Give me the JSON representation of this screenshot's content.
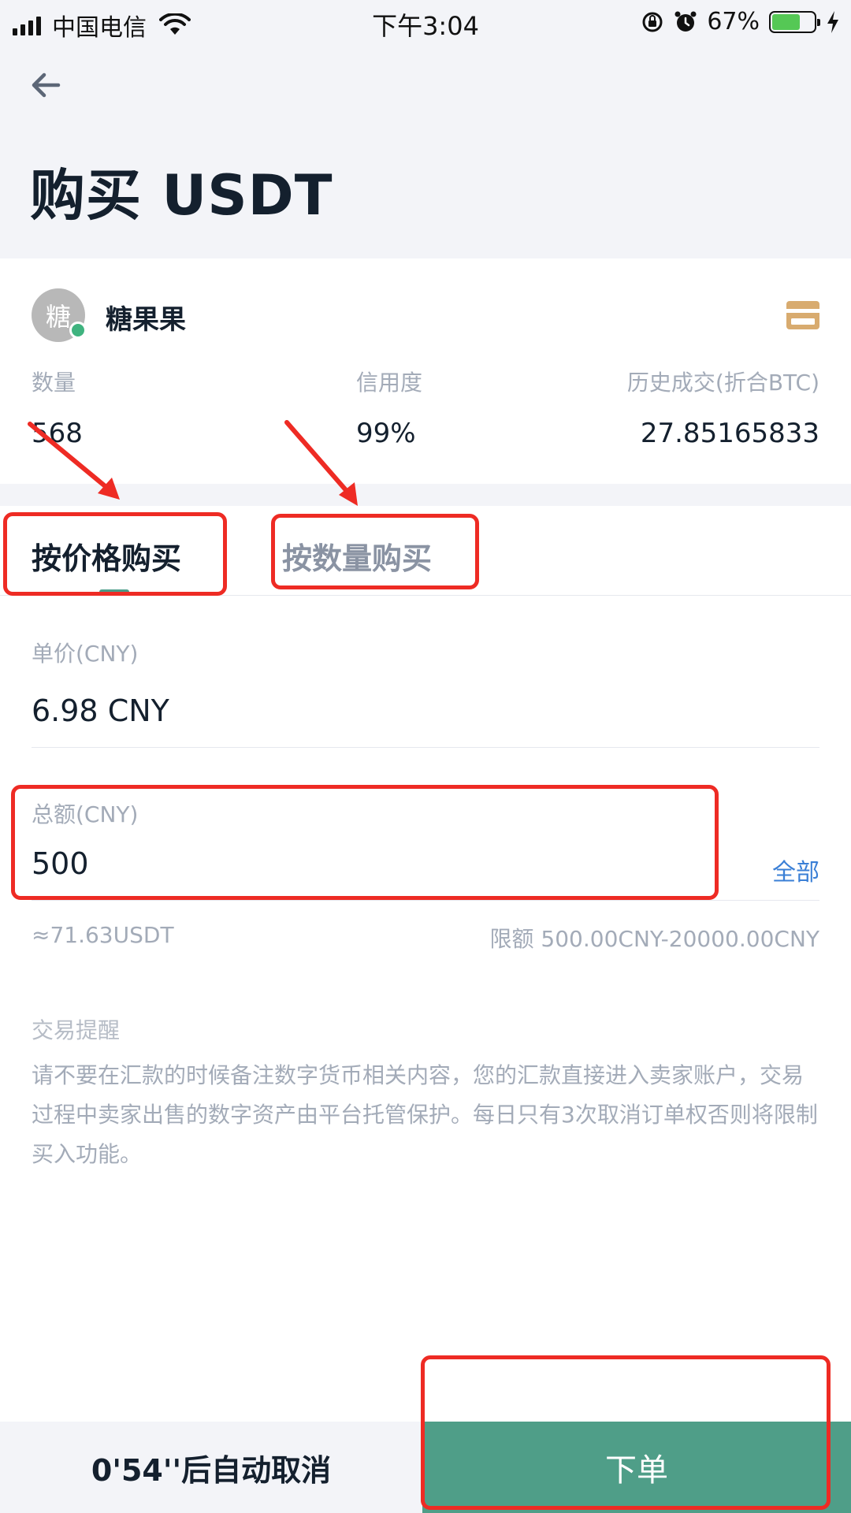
{
  "status_bar": {
    "carrier": "中国电信",
    "time": "下午3:04",
    "battery_pct": "67%",
    "battery_level": 0.67,
    "battery_color": "#55c855"
  },
  "header": {
    "back_icon": "arrow-left-icon",
    "title": "购买 USDT"
  },
  "seller": {
    "avatar_text": "糖",
    "name": "糖果果",
    "online_color": "#3fb37f",
    "payment_icon": "bank-card-icon",
    "stats": [
      {
        "label": "数量",
        "value": "568"
      },
      {
        "label": "信用度",
        "value": "99%"
      },
      {
        "label": "历史成交(折合BTC)",
        "value": "27.85165833"
      }
    ]
  },
  "tabs": [
    {
      "label": "按价格购买",
      "active": true
    },
    {
      "label": "按数量购买",
      "active": false
    }
  ],
  "form": {
    "price_label": "单价(CNY)",
    "price_value": "6.98 CNY",
    "total_label": "总额(CNY)",
    "total_value": "500",
    "all_label": "全部",
    "approx": "≈71.63USDT",
    "limit": "限额 500.00CNY-20000.00CNY"
  },
  "tip": {
    "title": "交易提醒",
    "body": "请不要在汇款的时候备注数字货币相关内容，您的汇款直接进入卖家账户，交易过程中卖家出售的数字资产由平台托管保护。每日只有3次取消订单权否则将限制买入功能。"
  },
  "bottom": {
    "countdown": "0'54''后自动取消",
    "order_label": "下单"
  },
  "colors": {
    "accent": "#4f9e88",
    "link": "#3a7fd6",
    "annotation": "#ee2b24"
  }
}
